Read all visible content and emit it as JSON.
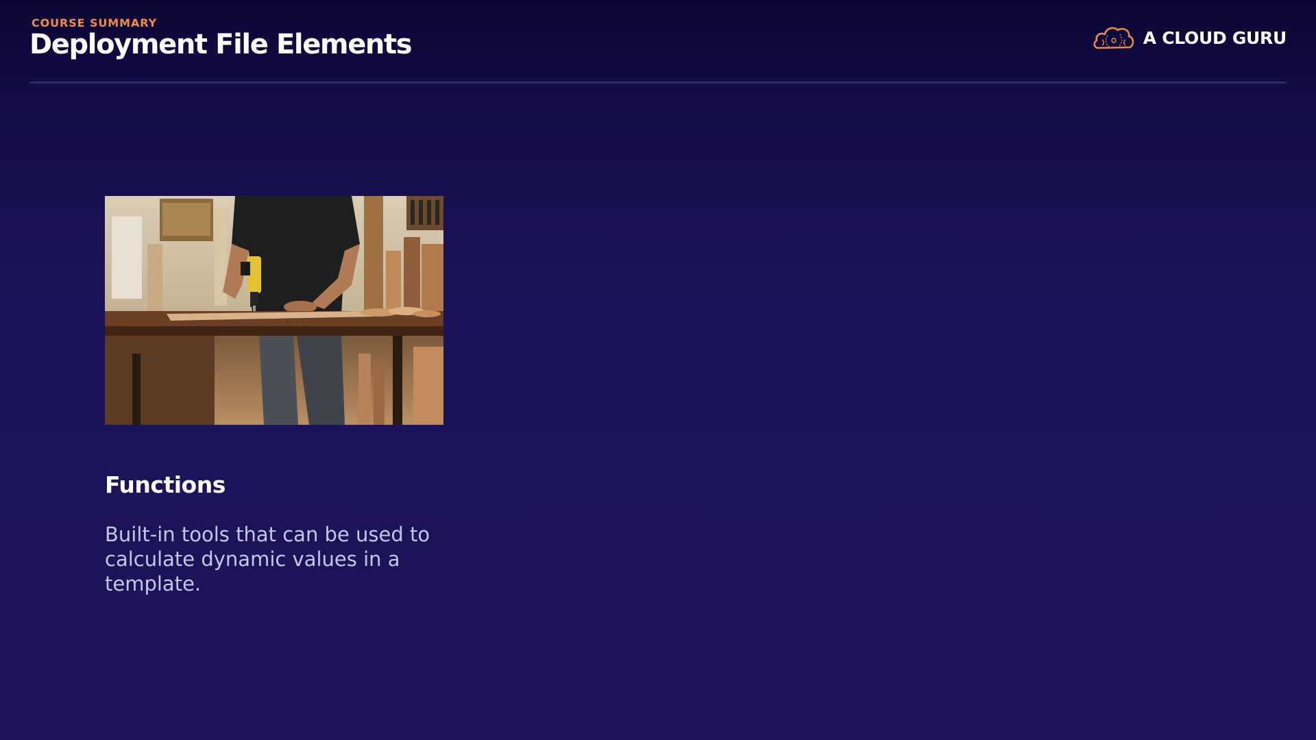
{
  "header": {
    "eyebrow": "COURSE SUMMARY",
    "title": "Deployment File Elements"
  },
  "brand": {
    "name": "A CLOUD GURU",
    "logo_icon": "cloud-logo-icon",
    "logo_color": "#f08a4b"
  },
  "card": {
    "image_icon": "woodworker-drilling-photo",
    "title": "Functions",
    "description": "Built-in tools that can be used to calculate dynamic values in a template."
  },
  "colors": {
    "background_top": "#0c0633",
    "background_bottom": "#1c1359",
    "accent": "#f08a4b",
    "divider": "#2f2a63"
  }
}
